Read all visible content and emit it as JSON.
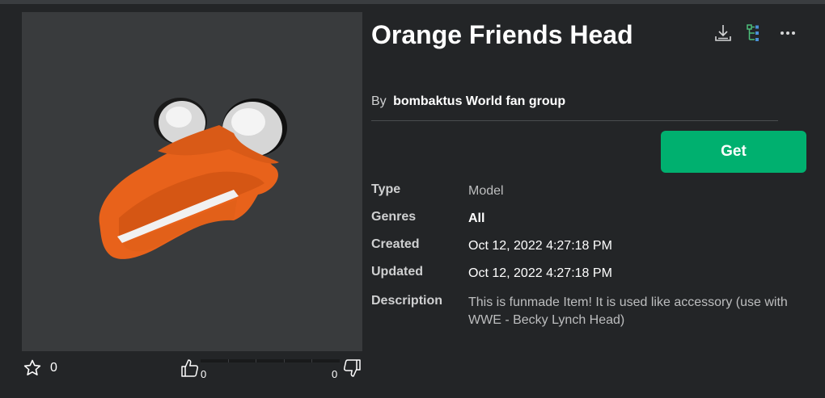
{
  "item": {
    "title": "Orange Friends Head",
    "by_label": "By",
    "creator": "bombaktus World fan group",
    "get_label": "Get"
  },
  "details": {
    "type_label": "Type",
    "type_value": "Model",
    "genres_label": "Genres",
    "genres_value": "All",
    "created_label": "Created",
    "created_value": "Oct 12, 2022 4:27:18 PM",
    "updated_label": "Updated",
    "updated_value": "Oct 12, 2022 4:27:18 PM",
    "description_label": "Description",
    "description_value": "This is funmade Item! It is used like accessory (use with WWE - Becky Lynch Head)"
  },
  "stats": {
    "favorites": "0",
    "upvotes": "0",
    "downvotes": "0"
  },
  "icons": {
    "favorite": "star-icon",
    "upvote": "thumbs-up-icon",
    "downvote": "thumbs-down-icon",
    "download": "download-icon",
    "hierarchy": "hierarchy-icon",
    "more": "more-options-icon"
  },
  "colors": {
    "background": "#232527",
    "preview_bg": "#393b3d",
    "accent_green": "#00b06f",
    "model_orange": "#e8621b"
  }
}
